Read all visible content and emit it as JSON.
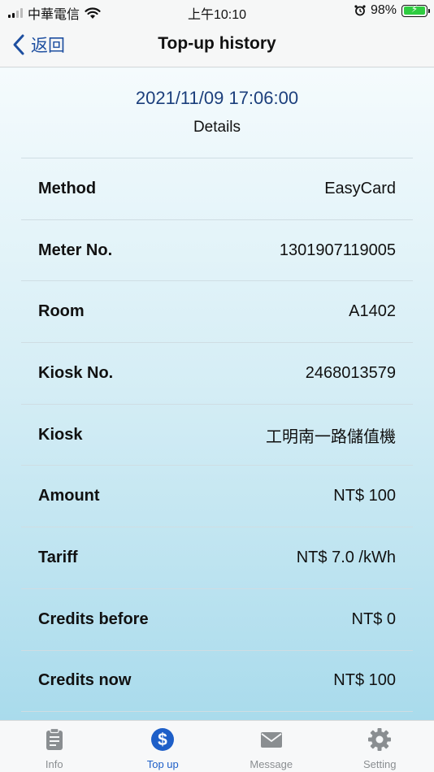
{
  "status_bar": {
    "carrier": "中華電信",
    "time": "上午10:10",
    "battery": "98%",
    "battery_level": 0.98
  },
  "nav": {
    "back_label": "返回",
    "title": "Top-up history"
  },
  "record": {
    "datetime": "2021/11/09 17:06:00",
    "section_label": "Details",
    "rows": [
      {
        "label": "Method",
        "value": "EasyCard"
      },
      {
        "label": "Meter No.",
        "value": "1301907119005"
      },
      {
        "label": "Room",
        "value": "A1402"
      },
      {
        "label": "Kiosk No.",
        "value": "2468013579"
      },
      {
        "label": "Kiosk",
        "value": "工明南一路儲值機"
      },
      {
        "label": "Amount",
        "value": "NT$ 100"
      },
      {
        "label": "Tariff",
        "value": "NT$ 7.0 /kWh"
      },
      {
        "label": "Credits before",
        "value": "NT$ 0"
      },
      {
        "label": "Credits now",
        "value": "NT$ 100"
      }
    ]
  },
  "tabs": [
    {
      "label": "Info",
      "icon": "clipboard-icon",
      "active": false
    },
    {
      "label": "Top up",
      "icon": "dollar-icon",
      "active": true
    },
    {
      "label": "Message",
      "icon": "envelope-icon",
      "active": false
    },
    {
      "label": "Setting",
      "icon": "gear-icon",
      "active": false
    }
  ],
  "colors": {
    "accent": "#1e5fc8",
    "date_heading": "#1c3f7c",
    "inactive_icon": "#8a8e91"
  }
}
